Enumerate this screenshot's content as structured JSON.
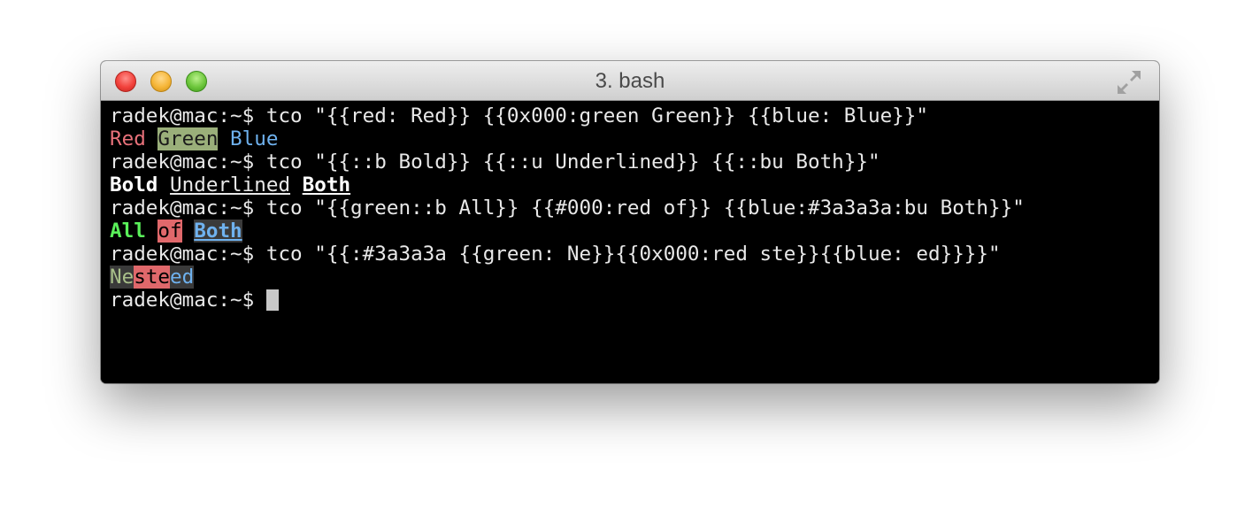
{
  "window": {
    "title": "3. bash",
    "buttons": {
      "close": "close",
      "minimize": "minimize",
      "zoom": "zoom"
    }
  },
  "terminal": {
    "prompt": "radek@mac:~$",
    "commands": [
      "tco \"{{red: Red}} {{0x000:green Green}} {{blue: Blue}}\"",
      "tco \"{{::b Bold}} {{::u Underlined}} {{::bu Both}}\"",
      "tco \"{{green::b All}} {{#000:red of}} {{blue:#3a3a3a:bu Both}}\"",
      "tco \"{{:#3a3a3a {{green: Ne}}{{0x000:red ste}}{{blue: ed}}}}\""
    ],
    "output1": {
      "red": "Red",
      "green": "Green",
      "blue": "Blue"
    },
    "output2": {
      "bold": "Bold",
      "underlined": "Underlined",
      "both": "Both"
    },
    "output3": {
      "all": "All",
      "of": "of",
      "both": "Both"
    },
    "output4": {
      "ne": "Ne",
      "ste": "ste",
      "ed": "ed"
    }
  },
  "colors": {
    "red": "#e8717a",
    "green_bg": "#9aaf7a",
    "blue": "#6fb2ef",
    "bright_green": "#5af05a",
    "red_bg": "#e0686b",
    "gray_bg": "#3a3a3a"
  },
  "icons": {
    "fullscreen": "fullscreen-icon"
  }
}
